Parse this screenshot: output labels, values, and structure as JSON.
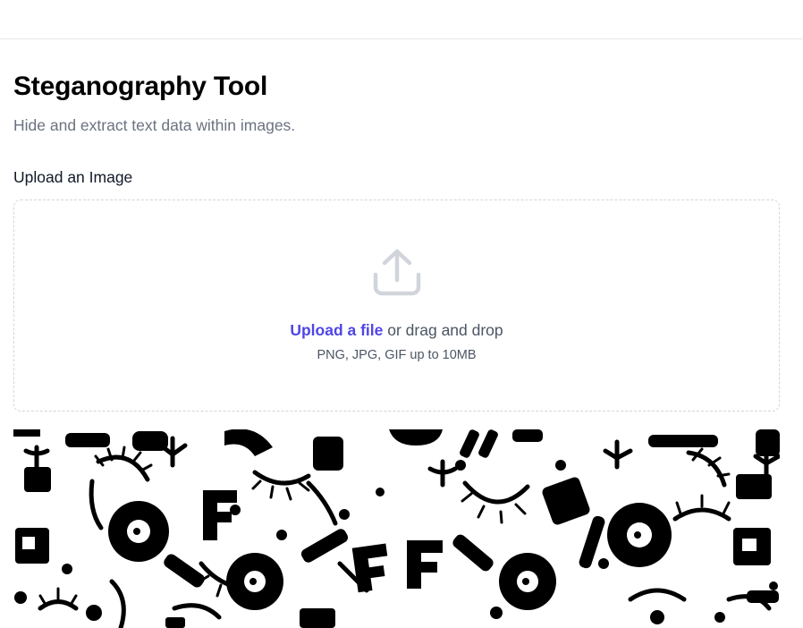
{
  "page": {
    "title": "Steganography Tool",
    "subtitle": "Hide and extract text data within images."
  },
  "upload": {
    "label": "Upload an Image",
    "link_text": "Upload a file",
    "drag_text": " or drag and drop",
    "hint": "PNG, JPG, GIF up to 10MB",
    "icon": "upload-icon"
  },
  "preview": {
    "icon": "image-preview",
    "colors": {
      "ink": "#000000",
      "paper": "#ffffff"
    }
  },
  "colors": {
    "accent": "#4f46e5",
    "muted_text": "#6b7280",
    "border": "#d1d5db"
  }
}
